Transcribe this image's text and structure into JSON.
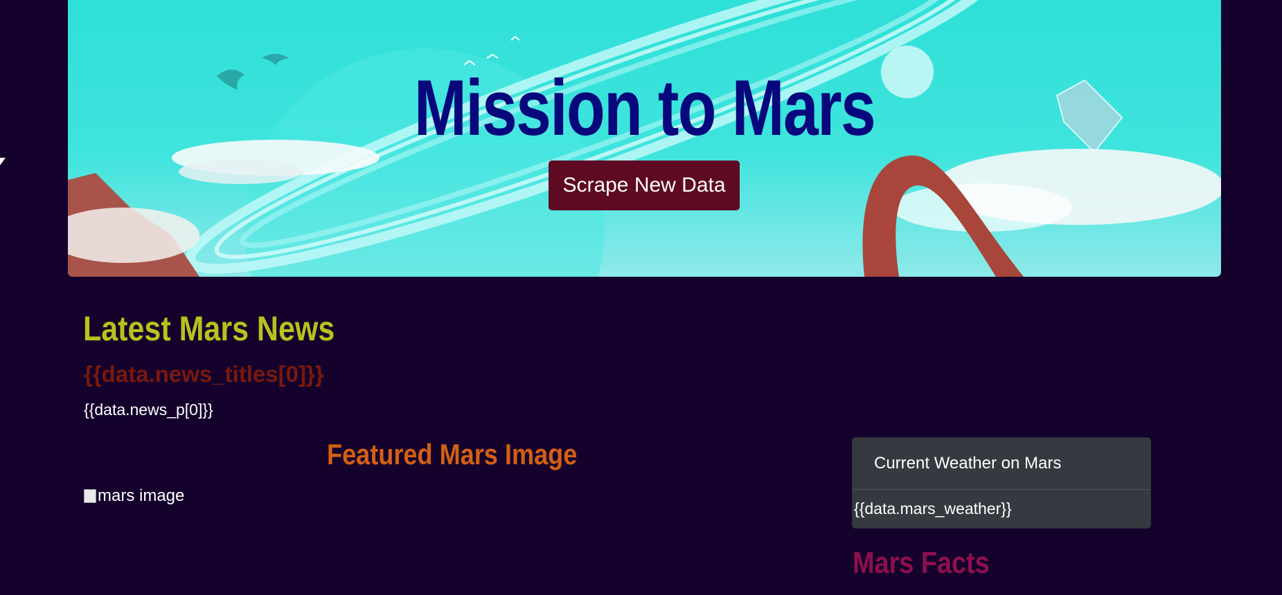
{
  "jumbotron": {
    "title": "Mission to Mars",
    "scrape_button_label": "Scrape New Data"
  },
  "news": {
    "heading": "Latest Mars News",
    "title": "{{data.news_titles[0]}}",
    "paragraph": "{{data.news_p[0]}}"
  },
  "featured_image": {
    "heading": "Featured Mars Image",
    "alt_text": "mars image"
  },
  "weather": {
    "card_title": "Current Weather on Mars",
    "value": "{{data.mars_weather}}"
  },
  "facts": {
    "heading": "Mars Facts"
  },
  "icons": [
    "cursor-icon",
    "broken-image-icon"
  ],
  "colors": {
    "page_background": "#14022c",
    "hero_title": "#08087d",
    "scrape_button": "#5d0a22",
    "news_heading": "#b7c21d",
    "news_title": "#7a180e",
    "featured_heading": "#d35f14",
    "weather_card": "#343a40",
    "facts_heading": "#8f0f4e"
  }
}
